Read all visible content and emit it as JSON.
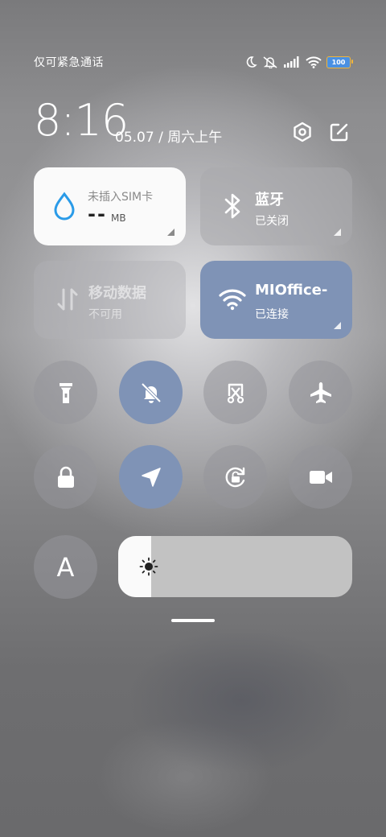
{
  "status_bar": {
    "carrier_text": "仅可紧急通话",
    "icons": [
      "moon-icon",
      "mute-icon",
      "signal-icon",
      "wifi-icon",
      "battery-icon"
    ],
    "battery_text": "100",
    "battery_color": "#4a90e2"
  },
  "header": {
    "time": "8:16",
    "date": "05.07 / 周六上午",
    "settings_icon": "hexagon-settings-icon",
    "edit_icon": "edit-icon"
  },
  "tiles": {
    "data_usage": {
      "title": "未插入SIM卡",
      "value": "--",
      "unit": "MB",
      "accent": "#2a9be8"
    },
    "bluetooth": {
      "title": "蓝牙",
      "status": "已关闭"
    },
    "mobile_data": {
      "title": "移动数据",
      "status": "不可用"
    },
    "wifi": {
      "title": "MIOffice-",
      "status": "已连接",
      "color": "#7f93b6"
    }
  },
  "toggles": [
    {
      "name": "flashlight",
      "active": false
    },
    {
      "name": "mute",
      "active": true
    },
    {
      "name": "screenshot",
      "active": false
    },
    {
      "name": "airplane",
      "active": false
    },
    {
      "name": "lock",
      "active": false
    },
    {
      "name": "location",
      "active": true
    },
    {
      "name": "rotation-lock",
      "active": false
    },
    {
      "name": "screen-record",
      "active": false
    }
  ],
  "font_size_button": {
    "label": "A"
  },
  "brightness": {
    "level": 0.14
  }
}
